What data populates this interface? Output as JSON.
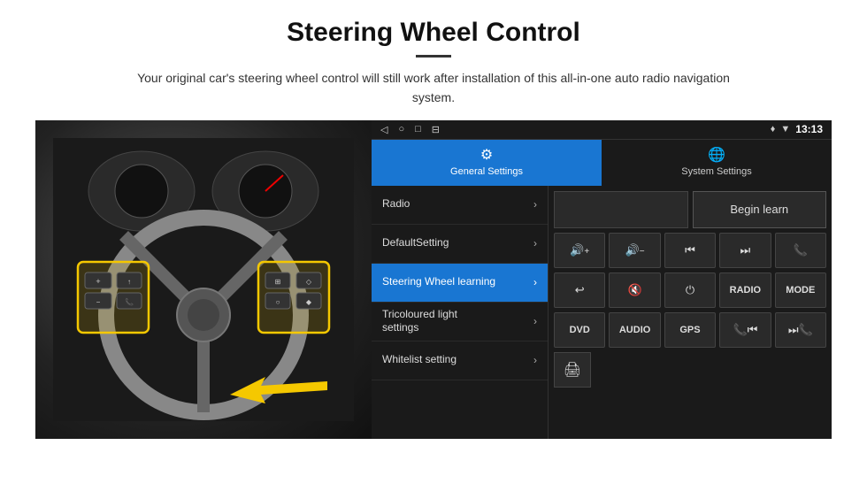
{
  "header": {
    "title": "Steering Wheel Control",
    "divider": true,
    "subtitle": "Your original car's steering wheel control will still work after installation of this all-in-one auto radio navigation system."
  },
  "status_bar": {
    "nav_icons": [
      "◁",
      "○",
      "□",
      "⊟"
    ],
    "right_icons": [
      "♦",
      "▼"
    ],
    "time": "13:13"
  },
  "tabs": [
    {
      "label": "General Settings",
      "icon": "⚙",
      "active": true
    },
    {
      "label": "System Settings",
      "icon": "🌐",
      "active": false
    }
  ],
  "menu_items": [
    {
      "label": "Radio",
      "active": false
    },
    {
      "label": "DefaultSetting",
      "active": false
    },
    {
      "label": "Steering Wheel learning",
      "active": true
    },
    {
      "label": "Tricoloured light settings",
      "active": false
    },
    {
      "label": "Whitelist setting",
      "active": false
    }
  ],
  "radio_row": {
    "empty_box": "",
    "begin_learn": "Begin learn"
  },
  "control_buttons_row1": [
    {
      "label": "🔊+",
      "type": "vol-up"
    },
    {
      "label": "🔊-",
      "type": "vol-down"
    },
    {
      "label": "⏮",
      "type": "prev-track"
    },
    {
      "label": "⏭",
      "type": "next-track"
    },
    {
      "label": "📞",
      "type": "call"
    }
  ],
  "control_buttons_row2": [
    {
      "label": "↩",
      "type": "hook"
    },
    {
      "label": "🔇",
      "type": "mute"
    },
    {
      "label": "⏻",
      "type": "power"
    },
    {
      "label": "RADIO",
      "type": "radio-text"
    },
    {
      "label": "MODE",
      "type": "mode-text"
    }
  ],
  "control_buttons_row3": [
    {
      "label": "DVD",
      "type": "dvd-text"
    },
    {
      "label": "AUDIO",
      "type": "audio-text"
    },
    {
      "label": "GPS",
      "type": "gps-text"
    },
    {
      "label": "📞⏮",
      "type": "call-prev"
    },
    {
      "label": "⏭📞",
      "type": "call-next"
    }
  ],
  "whitelist_icon": "🖨"
}
